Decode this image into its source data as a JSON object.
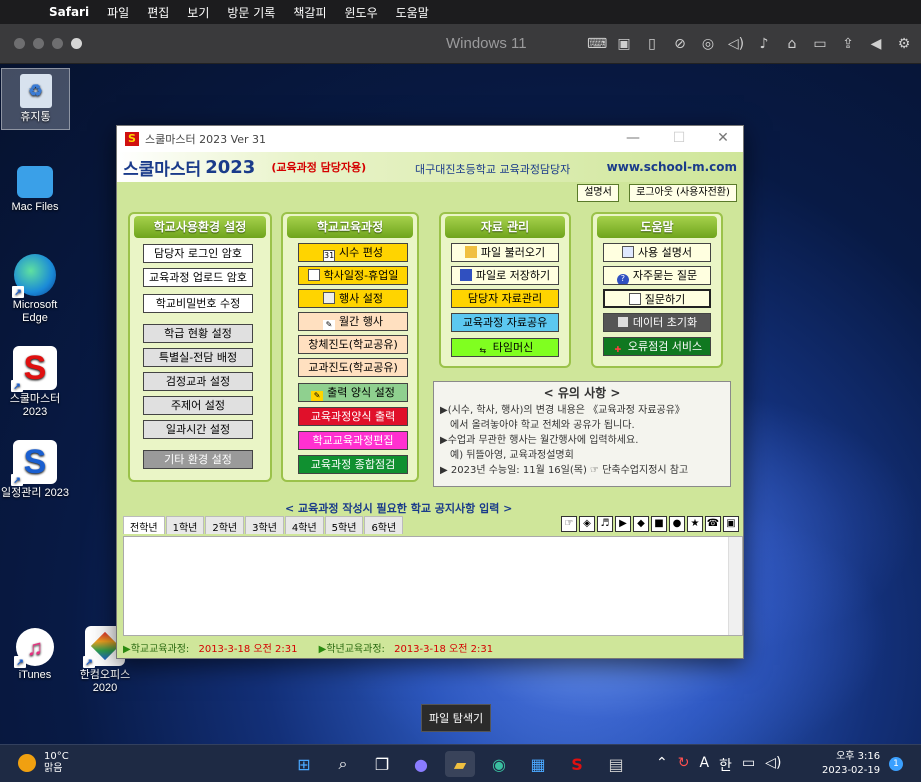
{
  "mac_menu": {
    "app": "Safari",
    "items": [
      "파일",
      "편집",
      "보기",
      "방문 기록",
      "책갈피",
      "윈도우",
      "도움말"
    ]
  },
  "vm": {
    "title": "Windows 11"
  },
  "desktop_icons": {
    "recycle": "휴지통",
    "macfiles": "Mac Files",
    "edge": "Microsoft Edge",
    "schoolmaster": "스쿨마스터 2023",
    "schedule": "일정관리 2023",
    "itunes": "iTunes",
    "hancom": "한컴오피스 2020"
  },
  "app": {
    "window_title": "스쿨마스터 2023   Ver 31",
    "brand": "스쿨마스터",
    "year": "2023",
    "role": "(교육과정 담당자용)",
    "school": "대구대진초등학교 교육과정담당자",
    "url": "www.school-m.com",
    "manual_btn": "설명서",
    "logout_btn": "로그아웃 (사용자전환)",
    "panel1": {
      "title": "학교사용환경 설정",
      "buttons": [
        "담당자 로그인 암호",
        "교육과정 업로드 암호",
        "학교비밀번호 수정",
        "학급 현황 설정",
        "특별실-전담 배정",
        "검정교과 설정",
        "주제어 설정",
        "일과시간 설정",
        "기타 환경 설정"
      ]
    },
    "panel2": {
      "title": "학교교육과정",
      "buttons": [
        "시수 편성",
        "학사일정-휴업일",
        "행사 설정",
        "월간 행사",
        "창체진도(학교공유)",
        "교과진도(학교공유)",
        "출력 양식 설정",
        "교육과정양식 출력",
        "학교교육과정편집",
        "교육과정 종합점검"
      ]
    },
    "panel3": {
      "title": "자료 관리",
      "buttons": [
        "파일 불러오기",
        "파일로 저장하기",
        "담당자 자료관리",
        "교육과정 자료공유",
        "타임머신"
      ]
    },
    "panel4": {
      "title": "도움말",
      "buttons": [
        "사용 설명서",
        "자주묻는 질문",
        "질문하기",
        "데이터 초기화",
        "오류점검 서비스"
      ]
    },
    "notice": {
      "title": "< 유의 사항 >",
      "line1": "▶(시수, 학사, 행사)의 변경 내용은 《교육과정 자료공유》",
      "line2": "에서 올려놓아야 학교 전체와 공유가 됩니다.",
      "line3": "▶수업과 무관한 행사는 월간행사에 입력하세요.",
      "line4": "예) 뒤뜰아영, 교육과정설명회",
      "line5": "▶ 2023년 수능일: 11월 16일(목) ☞ 단축수업지정시 참고"
    },
    "subtitle": "< 교육과정 작성시 필요한 학교 공지사항 입력 >",
    "tabs": [
      "전학년",
      "1학년",
      "2학년",
      "3학년",
      "4학년",
      "5학년",
      "6학년"
    ],
    "status": {
      "school_label": "학교교육과정:",
      "school_value": "2013-3-18 오전 2:31",
      "grade_label": "학년교육과정:",
      "grade_value": "2013-3-18 오전 2:31"
    }
  },
  "tooltip": "파일 탐색기",
  "taskbar": {
    "temp": "10°C",
    "weather": "맑음",
    "ime": "한",
    "lang": "A",
    "time": "오후 3:16",
    "date": "2023-02-19",
    "notif_count": "1"
  }
}
